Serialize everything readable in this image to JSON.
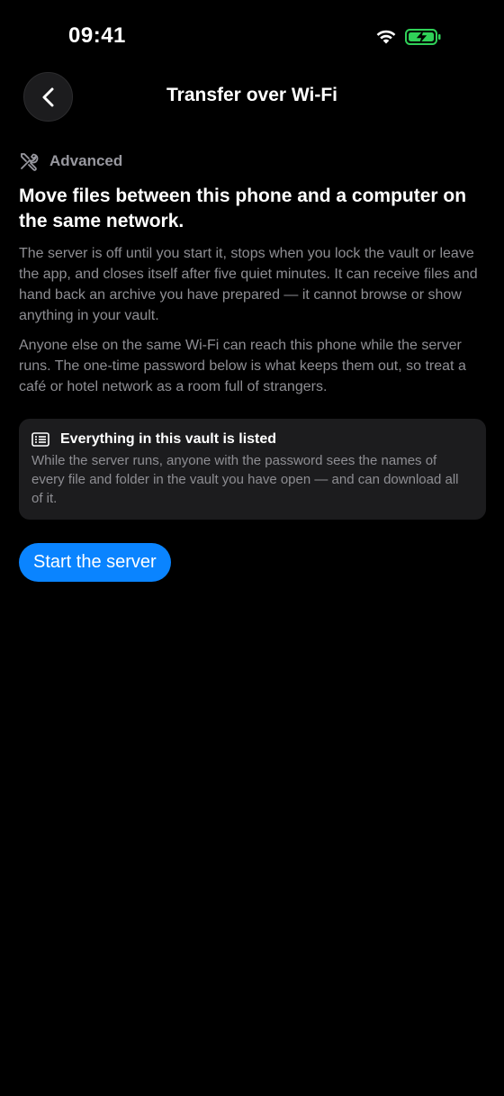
{
  "status_bar": {
    "time": "09:41",
    "icons": [
      "wifi-icon",
      "battery-charging-icon"
    ],
    "battery_color": "#30d158"
  },
  "nav": {
    "back_icon": "chevron-left-icon",
    "title": "Transfer over Wi-Fi"
  },
  "section": {
    "icon": "tools-icon",
    "label": "Advanced"
  },
  "headline": "Move files between this phone and a computer on the same network.",
  "paragraphs": [
    "The server is off until you start it, stops when you lock the vault or leave the app, and closes itself after five quiet minutes. It can receive files and hand back an archive you have prepared — it cannot browse or show anything in your vault.",
    "Anyone else on the same Wi-Fi can reach this phone while the server runs. The one-time password below is what keeps them out, so treat a café or hotel network as a room full of strangers."
  ],
  "notice": {
    "icon": "list-icon",
    "title": "Everything in this vault is listed",
    "body": "While the server runs, anyone with the password sees the names of every file and folder in the vault you have open — and can download all of it."
  },
  "primary_button": {
    "label": "Start the server",
    "color": "#0a84ff"
  }
}
